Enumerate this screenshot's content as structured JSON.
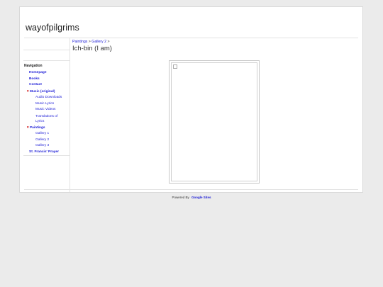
{
  "site": {
    "title": "wayofpilgrims"
  },
  "sidebar": {
    "nav_title": "Navigation",
    "items": [
      {
        "label": "Homepage"
      },
      {
        "label": "Books"
      },
      {
        "label": "Contact"
      },
      {
        "label": "Music (original)",
        "expanded": true,
        "children": [
          {
            "label": "Audio Downloads"
          },
          {
            "label": "Music Lyrics"
          },
          {
            "label": "Music Videos"
          },
          {
            "label": "Translations of Lyrics"
          }
        ]
      },
      {
        "label": "Paintings",
        "expanded": true,
        "children": [
          {
            "label": "Gallery 1"
          },
          {
            "label": "Gallery 2"
          },
          {
            "label": "Gallery 3"
          }
        ]
      },
      {
        "label": "St. Francis' Prayer"
      }
    ]
  },
  "breadcrumb": {
    "items": [
      "Paintings",
      "Gallery 2"
    ],
    "separator": ">"
  },
  "main": {
    "heading": "Ich-bin (I am)"
  },
  "footer": {
    "powered_by": "Powered By",
    "brand": "Google Sites"
  },
  "icons": {
    "expanded_marker": "triangle-down",
    "image": "broken-image-icon"
  },
  "colors": {
    "background": "#ebebeb",
    "link": "#1a1ad6",
    "expander": "#cc0000",
    "page": "#ffffff"
  }
}
